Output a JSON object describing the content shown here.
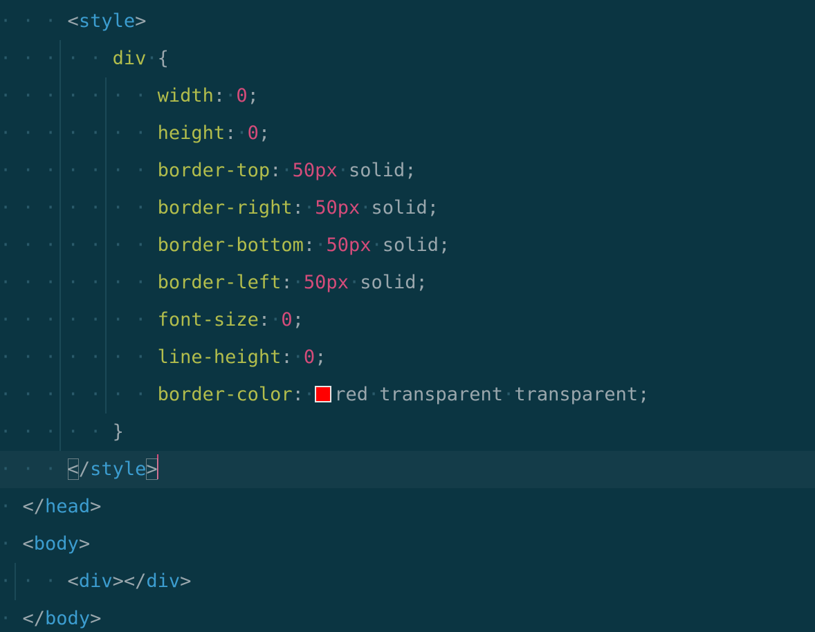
{
  "code": {
    "lines": [
      {
        "indent": 3,
        "guides": [],
        "segments": [
          {
            "cls": "punct",
            "key": "lt"
          },
          {
            "cls": "tag",
            "key": "style_open"
          },
          {
            "cls": "punct",
            "key": "gt"
          }
        ]
      },
      {
        "indent": 5,
        "guides": [
          1
        ],
        "segments": [
          {
            "cls": "selector",
            "key": "sel_div"
          },
          {
            "cls": "ws-dot",
            "key": "dot1"
          },
          {
            "cls": "brace",
            "key": "lbrace"
          }
        ]
      },
      {
        "indent": 7,
        "guides": [
          1,
          2
        ],
        "segments": [
          {
            "cls": "prop",
            "key": "p_width"
          },
          {
            "cls": "punct",
            "key": "colon"
          },
          {
            "cls": "ws-dot",
            "key": "dot1"
          },
          {
            "cls": "num",
            "key": "v_zero_a"
          },
          {
            "cls": "punct",
            "key": "semi"
          }
        ]
      },
      {
        "indent": 7,
        "guides": [
          1,
          2
        ],
        "segments": [
          {
            "cls": "prop",
            "key": "p_height"
          },
          {
            "cls": "punct",
            "key": "colon"
          },
          {
            "cls": "ws-dot",
            "key": "dot1"
          },
          {
            "cls": "num",
            "key": "v_zero_b"
          },
          {
            "cls": "punct",
            "key": "semi"
          }
        ]
      },
      {
        "indent": 7,
        "guides": [
          1,
          2
        ],
        "segments": [
          {
            "cls": "prop",
            "key": "p_btop"
          },
          {
            "cls": "punct",
            "key": "colon"
          },
          {
            "cls": "ws-dot",
            "key": "dot1"
          },
          {
            "cls": "num",
            "key": "v_50a"
          },
          {
            "cls": "ws-dot",
            "key": "dot1"
          },
          {
            "cls": "kw",
            "key": "kw_solid_a"
          },
          {
            "cls": "punct",
            "key": "semi"
          }
        ]
      },
      {
        "indent": 7,
        "guides": [
          1,
          2
        ],
        "segments": [
          {
            "cls": "prop",
            "key": "p_bright"
          },
          {
            "cls": "punct",
            "key": "colon"
          },
          {
            "cls": "ws-dot",
            "key": "dot1"
          },
          {
            "cls": "num",
            "key": "v_50b"
          },
          {
            "cls": "ws-dot",
            "key": "dot1"
          },
          {
            "cls": "kw",
            "key": "kw_solid_b"
          },
          {
            "cls": "punct",
            "key": "semi"
          }
        ]
      },
      {
        "indent": 7,
        "guides": [
          1,
          2
        ],
        "segments": [
          {
            "cls": "prop",
            "key": "p_bbottom"
          },
          {
            "cls": "punct",
            "key": "colon"
          },
          {
            "cls": "ws-dot",
            "key": "dot1"
          },
          {
            "cls": "num",
            "key": "v_50c"
          },
          {
            "cls": "ws-dot",
            "key": "dot1"
          },
          {
            "cls": "kw",
            "key": "kw_solid_c"
          },
          {
            "cls": "punct",
            "key": "semi"
          }
        ]
      },
      {
        "indent": 7,
        "guides": [
          1,
          2
        ],
        "segments": [
          {
            "cls": "prop",
            "key": "p_bleft"
          },
          {
            "cls": "punct",
            "key": "colon"
          },
          {
            "cls": "ws-dot",
            "key": "dot1"
          },
          {
            "cls": "num",
            "key": "v_50d"
          },
          {
            "cls": "ws-dot",
            "key": "dot1"
          },
          {
            "cls": "kw",
            "key": "kw_solid_d"
          },
          {
            "cls": "punct",
            "key": "semi"
          }
        ]
      },
      {
        "indent": 7,
        "guides": [
          1,
          2
        ],
        "segments": [
          {
            "cls": "prop",
            "key": "p_fsize"
          },
          {
            "cls": "punct",
            "key": "colon"
          },
          {
            "cls": "ws-dot",
            "key": "dot1"
          },
          {
            "cls": "num",
            "key": "v_zero_c"
          },
          {
            "cls": "punct",
            "key": "semi"
          }
        ]
      },
      {
        "indent": 7,
        "guides": [
          1,
          2
        ],
        "segments": [
          {
            "cls": "prop",
            "key": "p_lheight"
          },
          {
            "cls": "punct",
            "key": "colon"
          },
          {
            "cls": "ws-dot",
            "key": "dot1"
          },
          {
            "cls": "num",
            "key": "v_zero_d"
          },
          {
            "cls": "punct",
            "key": "semi"
          }
        ]
      },
      {
        "indent": 7,
        "guides": [
          1,
          2
        ],
        "segments": [
          {
            "cls": "prop",
            "key": "p_bcolor"
          },
          {
            "cls": "punct",
            "key": "colon"
          },
          {
            "cls": "ws-dot",
            "key": "dot1"
          },
          {
            "cls": "swatch",
            "key": ""
          },
          {
            "cls": "kw",
            "key": "kw_red"
          },
          {
            "cls": "ws-dot",
            "key": "dot1"
          },
          {
            "cls": "kw",
            "key": "kw_trans1"
          },
          {
            "cls": "ws-dot",
            "key": "dot1"
          },
          {
            "cls": "kw",
            "key": "kw_trans2"
          },
          {
            "cls": "punct",
            "key": "semi"
          }
        ]
      },
      {
        "indent": 5,
        "guides": [
          1
        ],
        "segments": [
          {
            "cls": "brace",
            "key": "rbrace"
          }
        ]
      },
      {
        "indent": 3,
        "guides": [],
        "current": true,
        "segments": [
          {
            "cls": "punct match",
            "key": "lt"
          },
          {
            "cls": "punct",
            "key": "slash"
          },
          {
            "cls": "tag",
            "key": "style_close"
          },
          {
            "cls": "punct match",
            "key": "gt"
          },
          {
            "cls": "caret",
            "key": ""
          }
        ]
      },
      {
        "indent": 1,
        "guides": [],
        "segments": [
          {
            "cls": "punct",
            "key": "lt"
          },
          {
            "cls": "punct",
            "key": "slash"
          },
          {
            "cls": "tag",
            "key": "tag_head"
          },
          {
            "cls": "punct",
            "key": "gt"
          }
        ]
      },
      {
        "indent": 1,
        "guides": [],
        "segments": [
          {
            "cls": "punct",
            "key": "lt"
          },
          {
            "cls": "tag",
            "key": "tag_body_open"
          },
          {
            "cls": "punct",
            "key": "gt"
          }
        ]
      },
      {
        "indent": 3,
        "guides": [
          0
        ],
        "segments": [
          {
            "cls": "punct",
            "key": "lt"
          },
          {
            "cls": "tag",
            "key": "tag_div_open"
          },
          {
            "cls": "punct",
            "key": "gt"
          },
          {
            "cls": "punct",
            "key": "lt"
          },
          {
            "cls": "punct",
            "key": "slash"
          },
          {
            "cls": "tag",
            "key": "tag_div_close"
          },
          {
            "cls": "punct",
            "key": "gt"
          }
        ]
      },
      {
        "indent": 1,
        "guides": [],
        "segments": [
          {
            "cls": "punct",
            "key": "lt"
          },
          {
            "cls": "punct",
            "key": "slash"
          },
          {
            "cls": "tag",
            "key": "tag_body_close"
          },
          {
            "cls": "punct",
            "key": "gt"
          }
        ]
      }
    ]
  },
  "tokens": {
    "lt": "<",
    "gt": ">",
    "slash": "/",
    "colon": ":",
    "semi": ";",
    "dot1": "·",
    "lbrace": "{",
    "rbrace": "}",
    "style_open": "style",
    "style_close": "style",
    "sel_div": "div",
    "p_width": "width",
    "p_height": "height",
    "p_btop": "border-top",
    "p_bright": "border-right",
    "p_bbottom": "border-bottom",
    "p_bleft": "border-left",
    "p_fsize": "font-size",
    "p_lheight": "line-height",
    "p_bcolor": "border-color",
    "v_zero_a": "0",
    "v_zero_b": "0",
    "v_zero_c": "0",
    "v_zero_d": "0",
    "v_50a": "50px",
    "v_50b": "50px",
    "v_50c": "50px",
    "v_50d": "50px",
    "kw_solid_a": "solid",
    "kw_solid_b": "solid",
    "kw_solid_c": "solid",
    "kw_solid_d": "solid",
    "kw_red": "red",
    "kw_trans1": "transparent",
    "kw_trans2": "transparent",
    "tag_head": "head",
    "tag_body_open": "body",
    "tag_body_close": "body",
    "tag_div_open": "div",
    "tag_div_close": "div"
  },
  "colors": {
    "swatch": "#ff0000"
  }
}
